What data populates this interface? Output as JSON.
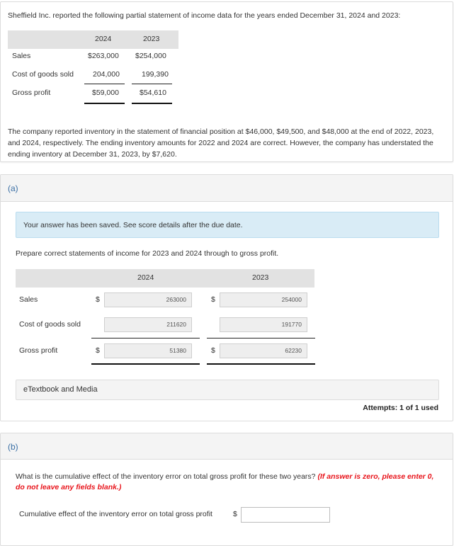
{
  "problem": {
    "intro": "Sheffield Inc. reported the following partial statement of income data for the years ended December 31, 2024 and 2023:",
    "given_table": {
      "headers": [
        "2024",
        "2023"
      ],
      "rows": [
        {
          "label": "Sales",
          "v2024": "$263,000",
          "v2023": "$254,000"
        },
        {
          "label": "Cost of goods sold",
          "v2024": "204,000",
          "v2023": "199,390"
        },
        {
          "label": "Gross profit",
          "v2024": "$59,000",
          "v2023": "$54,610"
        }
      ]
    },
    "description": "The company reported inventory in the statement of financial position at $46,000, $49,500, and $48,000 at the end of 2022, 2023, and 2024, respectively. The ending inventory amounts for 2022 and 2024 are correct. However, the company has understated the ending inventory at December 31, 2023, by $7,620."
  },
  "part_a": {
    "label": "(a)",
    "alert": "Your answer has been saved. See score details after the due date.",
    "instruction": "Prepare correct statements of income for 2023 and 2024 through to gross profit.",
    "headers": [
      "2024",
      "2023"
    ],
    "rows": [
      {
        "label": "Sales",
        "dollar2024": "$",
        "v2024": "263000",
        "dollar2023": "$",
        "v2023": "254000"
      },
      {
        "label": "Cost of goods sold",
        "dollar2024": "",
        "v2024": "211620",
        "dollar2023": "",
        "v2023": "191770"
      },
      {
        "label": "Gross profit",
        "dollar2024": "$",
        "v2024": "51380",
        "dollar2023": "$",
        "v2023": "62230"
      }
    ],
    "etextbook": "eTextbook and Media",
    "attempts": "Attempts: 1 of 1 used"
  },
  "part_b": {
    "label": "(b)",
    "question": "What is the cumulative effect of the inventory error on total gross profit for these two years?",
    "hint": "(If answer is zero, please enter 0, do not leave any fields blank.)",
    "field_label": "Cumulative effect of the inventory error on total gross profit",
    "dollar": "$",
    "field_value": ""
  }
}
